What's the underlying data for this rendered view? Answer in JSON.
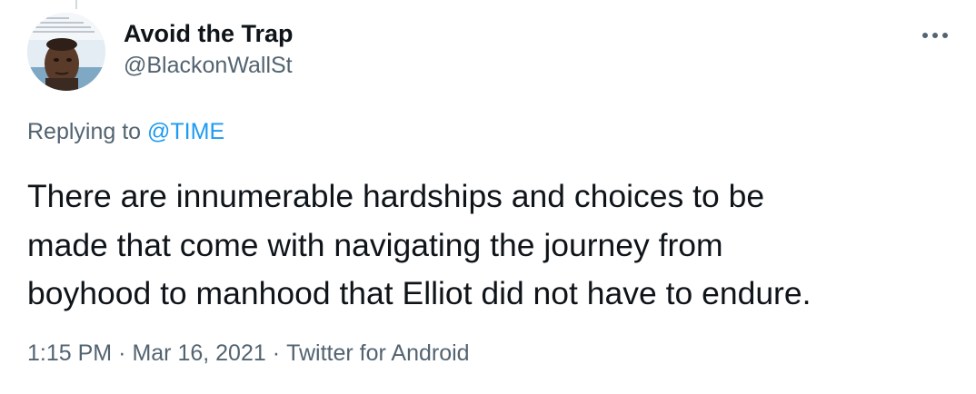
{
  "tweet": {
    "author": {
      "display_name": "Avoid the Trap",
      "handle": "@BlackonWallSt",
      "avatar_icon": "profile-photo"
    },
    "more_icon": "more-dots-icon",
    "reply": {
      "prefix": "Replying to",
      "mention": "@TIME"
    },
    "text_lines": [
      "There are innumerable hardships and choices to be",
      "made that come with navigating the journey from",
      "boyhood to manhood that Elliot did not have to endure."
    ],
    "meta": {
      "time": "1:15 PM",
      "separator": "·",
      "date": "Mar 16, 2021",
      "source": "Twitter for Android"
    }
  },
  "colors": {
    "text": "#0f1419",
    "secondary": "#536471",
    "link": "#1d9bf0",
    "thread_line": "#cfd9de"
  }
}
